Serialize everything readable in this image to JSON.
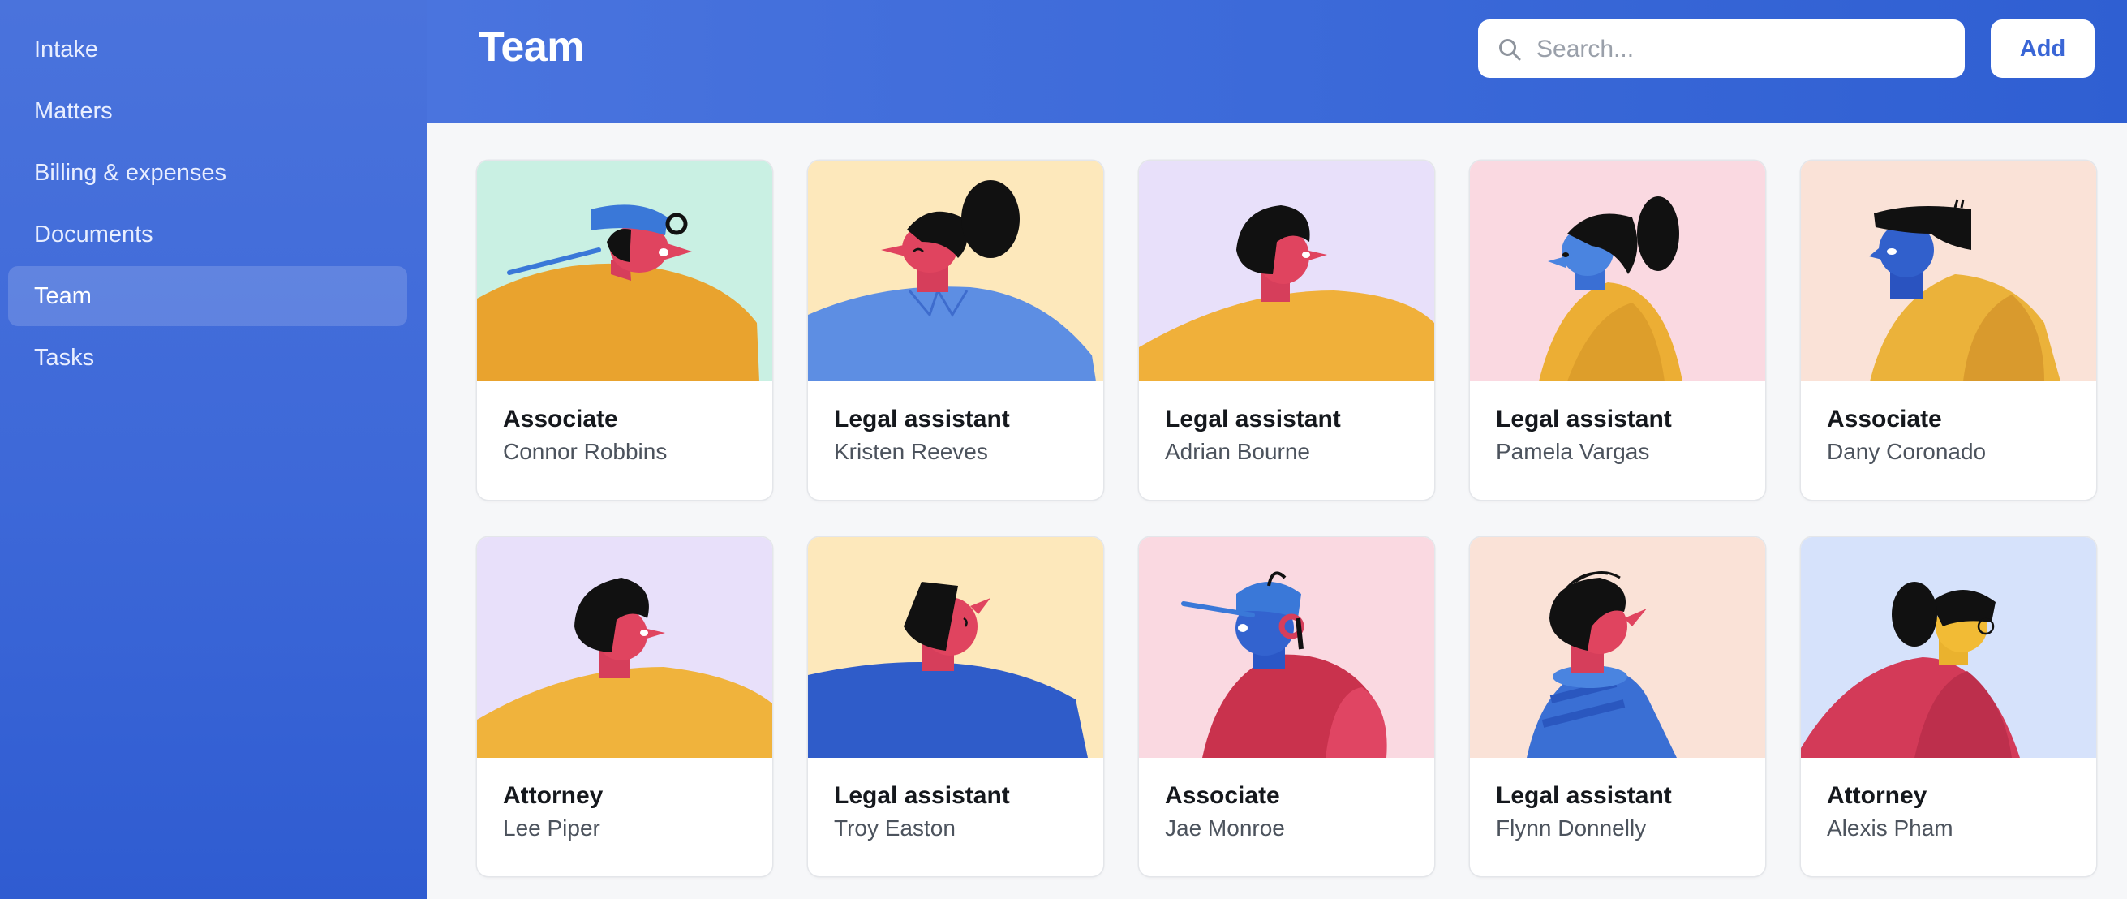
{
  "sidebar": {
    "items": [
      {
        "label": "Intake"
      },
      {
        "label": "Matters"
      },
      {
        "label": "Billing & expenses"
      },
      {
        "label": "Documents"
      },
      {
        "label": "Team",
        "active": true
      },
      {
        "label": "Tasks"
      }
    ]
  },
  "header": {
    "title": "Team",
    "search_placeholder": "Search...",
    "add_label": "Add"
  },
  "colors": {
    "accent": "#3c6ad9",
    "card_backgrounds": [
      "#c9f0e3",
      "#fde8bb",
      "#e8e0fa",
      "#fad9e1",
      "#fae2d7",
      "#d6e2fb"
    ]
  },
  "team": [
    {
      "role": "Associate",
      "name": "Connor Robbins"
    },
    {
      "role": "Legal assistant",
      "name": "Kristen Reeves"
    },
    {
      "role": "Legal assistant",
      "name": "Adrian Bourne"
    },
    {
      "role": "Legal assistant",
      "name": "Pamela Vargas"
    },
    {
      "role": "Associate",
      "name": "Dany Coronado"
    },
    {
      "role": "Attorney",
      "name": "Lee Piper"
    },
    {
      "role": "Legal assistant",
      "name": "Troy Easton"
    },
    {
      "role": "Associate",
      "name": "Jae Monroe"
    },
    {
      "role": "Legal assistant",
      "name": "Flynn Donnelly"
    },
    {
      "role": "Attorney",
      "name": "Alexis Pham"
    }
  ]
}
